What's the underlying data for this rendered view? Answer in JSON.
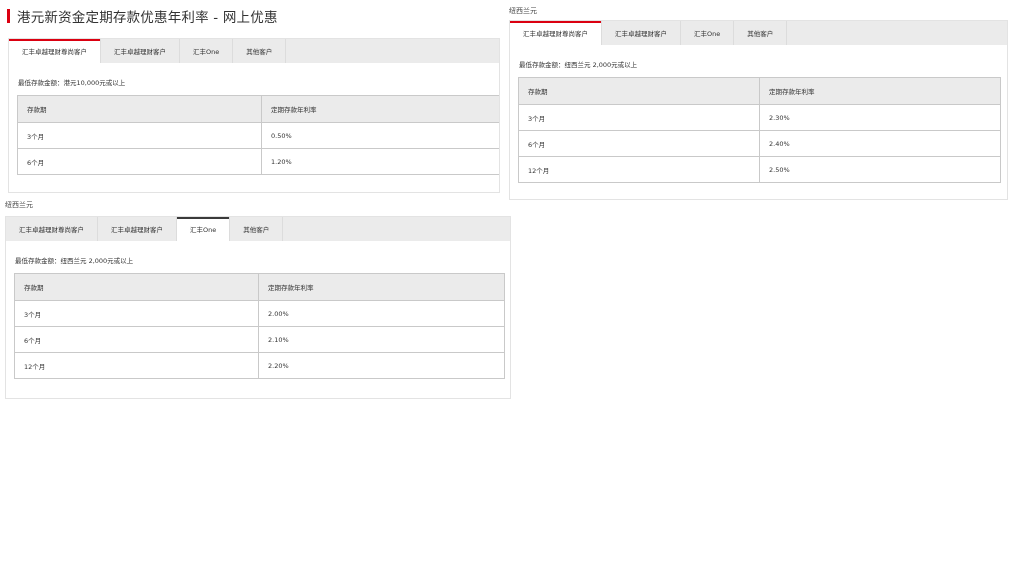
{
  "page_title": "港元新资金定期存款优惠年利率 - 网上优惠",
  "tab_labels": [
    "汇丰卓越理财尊尚客户",
    "汇丰卓越理财客户",
    "汇丰One",
    "其他客户"
  ],
  "hkd": {
    "min_amount": "最低存款金额：港元10,000元或以上",
    "headers": [
      "存款期",
      "定期存款年利率"
    ],
    "rows": [
      {
        "term": "3个月",
        "rate": "0.50%"
      },
      {
        "term": "6个月",
        "rate": "1.20%"
      }
    ]
  },
  "nzd_right": {
    "label": "纽西兰元",
    "min_amount": "最低存款金额：纽西兰元 2,000元或以上",
    "headers": [
      "存款期",
      "定期存款年利率"
    ],
    "rows": [
      {
        "term": "3个月",
        "rate": "2.30%"
      },
      {
        "term": "6个月",
        "rate": "2.40%"
      },
      {
        "term": "12个月",
        "rate": "2.50%"
      }
    ]
  },
  "nzd_left": {
    "label": "纽西兰元",
    "min_amount": "最低存款金额：纽西兰元 2,000元或以上",
    "headers": [
      "存款期",
      "定期存款年利率"
    ],
    "rows": [
      {
        "term": "3个月",
        "rate": "2.00%"
      },
      {
        "term": "6个月",
        "rate": "2.10%"
      },
      {
        "term": "12个月",
        "rate": "2.20%"
      }
    ]
  },
  "colors": {
    "accent_red": "#db0011",
    "tab_bar_bg": "#ebebeb",
    "active_indicator_dark": "#3a3a3a"
  }
}
